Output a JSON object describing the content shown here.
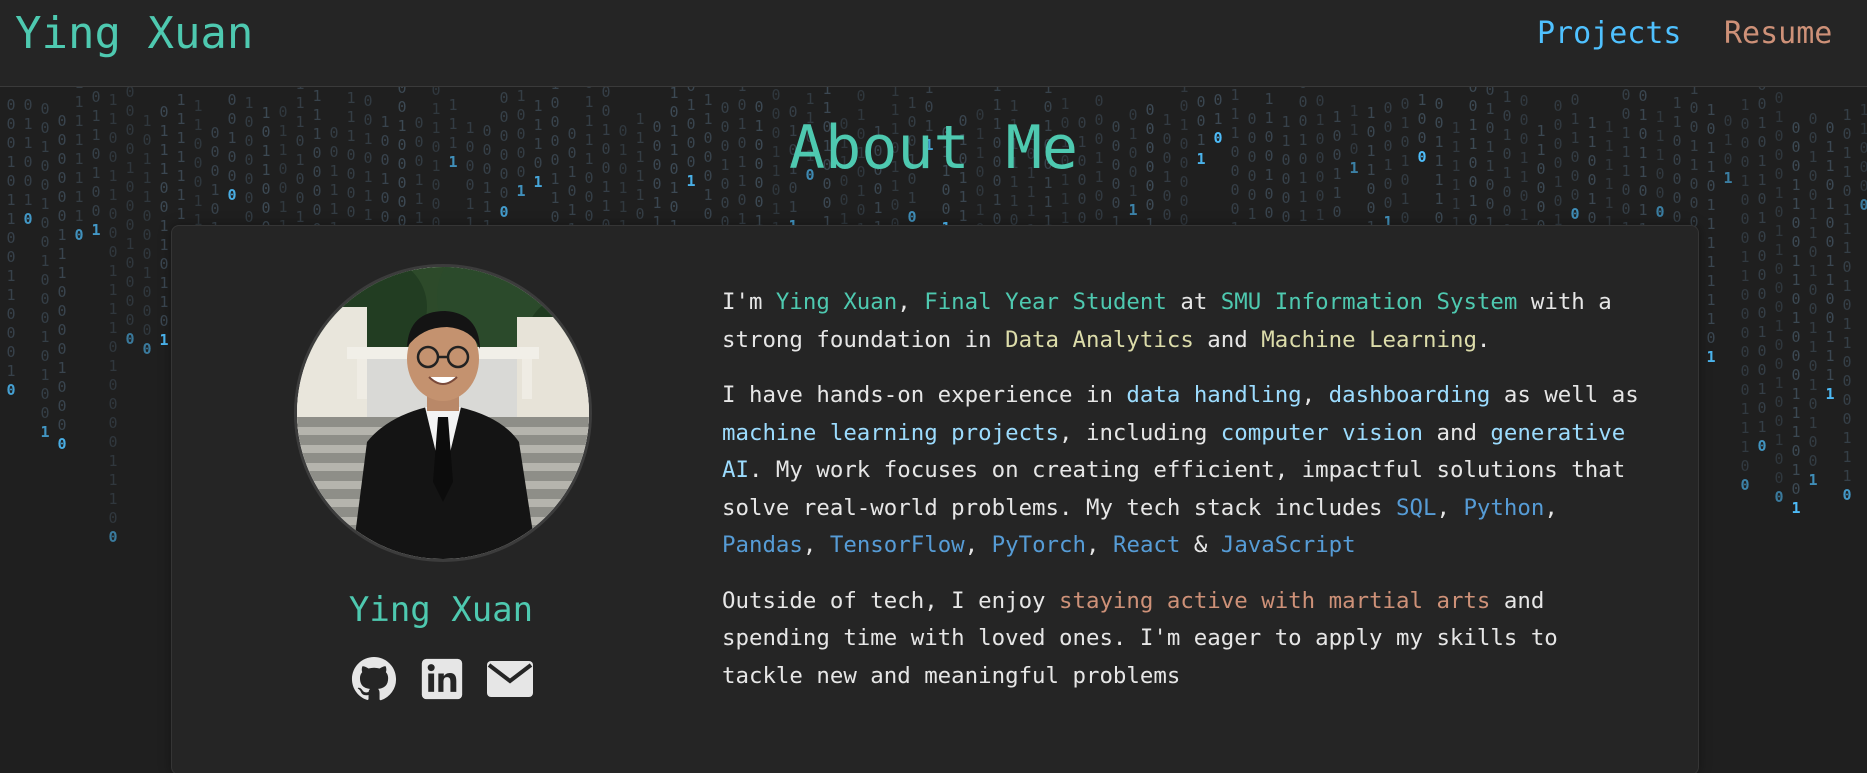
{
  "navbar": {
    "brand": "Ying Xuan",
    "links": [
      {
        "label": "Projects",
        "color": "#4fc1ff"
      },
      {
        "label": "Resume",
        "color": "#ce9178"
      }
    ]
  },
  "about": {
    "title": "About Me",
    "profile_name": "Ying Xuan",
    "avatar_icon": "profile-photo",
    "socials": [
      {
        "name": "github-icon"
      },
      {
        "name": "linkedin-icon"
      },
      {
        "name": "email-icon"
      }
    ],
    "bio": {
      "p1": {
        "t1": "I'm ",
        "name": "Ying Xuan",
        "t2": ", ",
        "role": "Final Year Student",
        "t3": " at ",
        "school": "SMU Information System",
        "t4": " with a strong foundation in ",
        "skill1": "Data Analytics",
        "t5": " and ",
        "skill2": "Machine Learning",
        "t6": "."
      },
      "p2": {
        "t1": "I have hands-on experience in ",
        "k1": "data handling",
        "t2": ", ",
        "k2": "dashboarding",
        "t3": " as well as ",
        "k3": "machine learning projects",
        "t4": ", including ",
        "k4": "computer vision",
        "t5": " and ",
        "k5": "generative AI",
        "t6": ". My work focuses on creating efficient, impactful solutions that solve real-world problems. My tech stack includes ",
        "tech": [
          "SQL",
          "Python",
          "Pandas",
          "TensorFlow",
          "PyTorch",
          "React",
          "JavaScript"
        ],
        "sep": ", ",
        "amp": " & "
      },
      "p3": {
        "t1": "Outside of tech, I enjoy ",
        "hobby": "staying active with martial arts",
        "t2": " and spending time with loved ones. I'm eager to apply my skills to tackle new and meaningful problems"
      }
    }
  },
  "colors": {
    "background": "#1f1f1f",
    "card": "#252525",
    "accent_teal": "#4ec9b0",
    "accent_blue": "#4fc1ff",
    "accent_orange": "#ce9178",
    "accent_yellow": "#dcdcaa"
  }
}
